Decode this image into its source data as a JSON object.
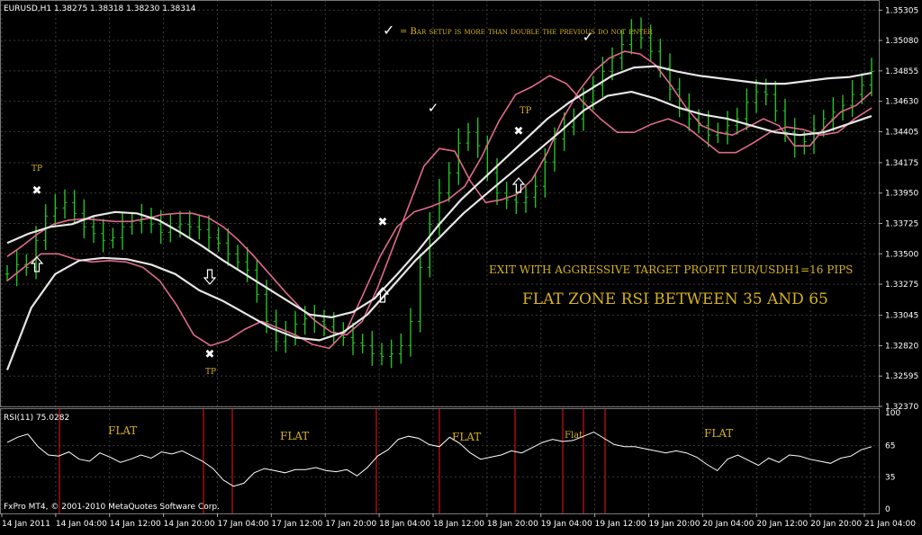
{
  "window": {
    "symbol_header": "EURUSD,H1  1.38275 1.38318 1.38230 1.38314",
    "rsi_header": "RSI(11) 75.0282",
    "copyright": "FxPro MT4, © 2001-2010 MetaQuotes Software Corp."
  },
  "colors": {
    "background": "#000000",
    "grid": "#3a3a3a",
    "candles": "#22c222",
    "ma_fast": "#e06a8a",
    "ma_slow": "#e6e6e6",
    "rsi_line": "#ffffff",
    "separator": "#cc1111",
    "annotation": "#d6b21c"
  },
  "chart_data": [
    {
      "type": "line",
      "title": "EURUSD,H1",
      "y_ticks": [
        "1.35305",
        "1.35080",
        "1.34855",
        "1.34630",
        "1.34405",
        "1.34175",
        "1.33950",
        "1.33725",
        "1.33500",
        "1.33275",
        "1.33045",
        "1.32820",
        "1.32595",
        "1.32370"
      ],
      "ylim": [
        1.3237,
        1.3538
      ],
      "x_ticks": [
        "14 Jan 2011",
        "14 Jan 04:00",
        "14 Jan 12:00",
        "14 Jan 20:00",
        "17 Jan 04:00",
        "17 Jan 12:00",
        "17 Jan 20:00",
        "18 Jan 04:00",
        "18 Jan 12:00",
        "18 Jan 20:00",
        "19 Jan 04:00",
        "19 Jan 12:00",
        "19 Jan 20:00",
        "20 Jan 04:00",
        "20 Jan 12:00",
        "20 Jan 20:00",
        "21 Jan 04:00"
      ],
      "grid": true,
      "close": [
        1.3335,
        1.3342,
        1.334,
        1.336,
        1.3378,
        1.3384,
        1.3388,
        1.338,
        1.337,
        1.3365,
        1.336,
        1.3362,
        1.337,
        1.3374,
        1.3376,
        1.3372,
        1.3366,
        1.337,
        1.3372,
        1.337,
        1.3368,
        1.3362,
        1.3358,
        1.335,
        1.3344,
        1.3338,
        1.332,
        1.33,
        1.3285,
        1.329,
        1.3298,
        1.3302,
        1.33,
        1.3296,
        1.3292,
        1.3288,
        1.3284,
        1.3282,
        1.3276,
        1.3274,
        1.3276,
        1.3282,
        1.33,
        1.334,
        1.3372,
        1.3395,
        1.341,
        1.3432,
        1.344,
        1.343,
        1.341,
        1.3395,
        1.339,
        1.3388,
        1.3392,
        1.34,
        1.3418,
        1.3435,
        1.3444,
        1.345,
        1.3462,
        1.3475,
        1.3485,
        1.3495,
        1.3505,
        1.3515,
        1.351,
        1.35,
        1.3488,
        1.3472,
        1.3458,
        1.345,
        1.3445,
        1.3438,
        1.344,
        1.3445,
        1.345,
        1.3462,
        1.347,
        1.3468,
        1.3456,
        1.344,
        1.343,
        1.3433,
        1.3442,
        1.345,
        1.3455,
        1.346,
        1.3468,
        1.3475,
        1.3485
      ],
      "series": [
        {
          "values": [
            1.3348,
            1.3356,
            1.3365,
            1.3372,
            1.3375,
            1.3376,
            1.3375,
            1.3374,
            1.3374,
            1.3376,
            1.3379,
            1.338,
            1.338,
            1.3377,
            1.337,
            1.336,
            1.3348,
            1.3335,
            1.3322,
            1.331,
            1.33,
            1.3292,
            1.329,
            1.33,
            1.3325,
            1.3355,
            1.3385,
            1.3415,
            1.3428,
            1.3426,
            1.3404,
            1.3388,
            1.339,
            1.3394,
            1.3405,
            1.3425,
            1.345,
            1.347,
            1.3485,
            1.3495,
            1.35,
            1.3498,
            1.349,
            1.3475,
            1.3458,
            1.3445,
            1.344,
            1.3438,
            1.3444,
            1.345,
            1.3445,
            1.343,
            1.343,
            1.3444,
            1.3455,
            1.346,
            1.347
          ]
        },
        {
          "values": [
            1.333,
            1.334,
            1.335,
            1.335,
            1.3346,
            1.3344,
            1.3345,
            1.3344,
            1.334,
            1.333,
            1.3312,
            1.329,
            1.3282,
            1.3286,
            1.3294,
            1.33,
            1.3295,
            1.329,
            1.3283,
            1.328,
            1.3293,
            1.332,
            1.3348,
            1.337,
            1.3381,
            1.3385,
            1.339,
            1.34,
            1.3422,
            1.3448,
            1.3468,
            1.3474,
            1.3482,
            1.3476,
            1.3462,
            1.345,
            1.344,
            1.344,
            1.3446,
            1.345,
            1.3445,
            1.3435,
            1.3425,
            1.3425,
            1.3432,
            1.344,
            1.3444,
            1.3442,
            1.3438,
            1.344,
            1.345,
            1.3458
          ]
        },
        {
          "values": [
            1.3358,
            1.3365,
            1.337,
            1.3372,
            1.3378,
            1.3381,
            1.338,
            1.3375,
            1.3366,
            1.3356,
            1.3345,
            1.3335,
            1.3325,
            1.3315,
            1.3305,
            1.3303,
            1.3307,
            1.3317,
            1.3334,
            1.3352,
            1.3372,
            1.339,
            1.3405,
            1.342,
            1.3435,
            1.345,
            1.3462,
            1.3472,
            1.3482,
            1.3488,
            1.3489,
            1.3485,
            1.3482,
            1.348,
            1.3478,
            1.3476,
            1.3476,
            1.3478,
            1.348,
            1.3481,
            1.3484
          ]
        },
        {
          "values": [
            1.3264,
            1.331,
            1.3335,
            1.3345,
            1.3347,
            1.3346,
            1.3342,
            1.3335,
            1.3323,
            1.3315,
            1.3305,
            1.3295,
            1.3288,
            1.3286,
            1.3292,
            1.3305,
            1.3325,
            1.3345,
            1.3362,
            1.338,
            1.3395,
            1.341,
            1.3425,
            1.344,
            1.3456,
            1.3467,
            1.347,
            1.3465,
            1.3458,
            1.3453,
            1.345,
            1.3445,
            1.344,
            1.3438,
            1.344,
            1.3446,
            1.3452
          ]
        }
      ]
    },
    {
      "type": "line",
      "title": "RSI(11) 75.0282",
      "y_ticks": [
        "100",
        "65",
        "35",
        "0"
      ],
      "ylim": [
        0,
        100
      ],
      "values": [
        68,
        73,
        76,
        64,
        56,
        55,
        59,
        52,
        50,
        58,
        54,
        49,
        52,
        56,
        53,
        59,
        57,
        60,
        55,
        50,
        43,
        32,
        26,
        29,
        39,
        43,
        41,
        39,
        42,
        42,
        44,
        41,
        40,
        42,
        36,
        44,
        55,
        61,
        71,
        74,
        72,
        66,
        64,
        73,
        67,
        58,
        52,
        54,
        56,
        60,
        58,
        63,
        68,
        71,
        69,
        70,
        74,
        78,
        72,
        66,
        64,
        64,
        62,
        60,
        58,
        60,
        58,
        54,
        47,
        41,
        52,
        56,
        51,
        46,
        53,
        49,
        56,
        55,
        52,
        50,
        48,
        53,
        55,
        61,
        64
      ]
    }
  ],
  "annotations": {
    "header_note": "= Bar setup is more than double the previous do not enter",
    "exit_note": "EXIT WITH AGGRESSIVE TARGET PROFIT EUR/USDH1=16 PIPS",
    "flat_note": "FLAT ZONE RSI BETWEEN 35 AND 65",
    "tp": "TP",
    "flat": "FLAT",
    "flat_small": "Flat"
  }
}
